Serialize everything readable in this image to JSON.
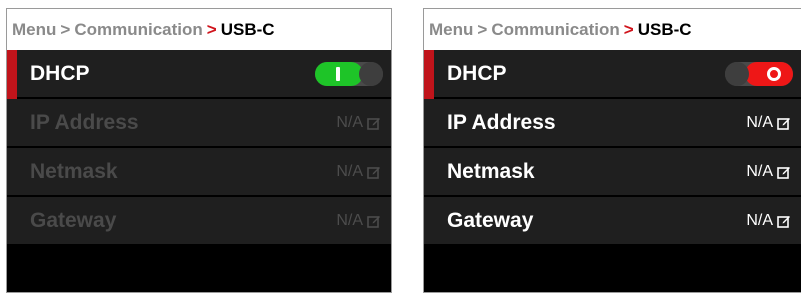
{
  "panels": [
    {
      "breadcrumb": {
        "root": "Menu",
        "sep1": ">",
        "middle": "Communication",
        "sep2": ">",
        "current": "USB-C"
      },
      "rows": [
        {
          "label": "DHCP",
          "toggle_state": "on"
        },
        {
          "label": "IP Address",
          "value": "N/A"
        },
        {
          "label": "Netmask",
          "value": "N/A"
        },
        {
          "label": "Gateway",
          "value": "N/A"
        }
      ]
    },
    {
      "breadcrumb": {
        "root": "Menu",
        "sep1": ">",
        "middle": "Communication",
        "sep2": ">",
        "current": "USB-C"
      },
      "rows": [
        {
          "label": "DHCP",
          "toggle_state": "off"
        },
        {
          "label": "IP Address",
          "value": "N/A"
        },
        {
          "label": "Netmask",
          "value": "N/A"
        },
        {
          "label": "Gateway",
          "value": "N/A"
        }
      ]
    }
  ],
  "colors": {
    "accent_red": "#c0141b",
    "toggle_on_green": "#1ec428",
    "toggle_off_red": "#ee1717",
    "row_bg": "#1f1f1f",
    "disabled_text": "#4a4a4a"
  },
  "icons": {
    "edit": "edit-icon"
  }
}
